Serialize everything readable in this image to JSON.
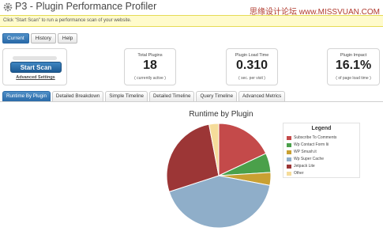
{
  "app": {
    "title": "P3 - Plugin Performance Profiler",
    "watermark": "思缘设计论坛 www.MISSVUAN.COM"
  },
  "notice": {
    "text": "Click \"Start Scan\" to run a performance scan of your website."
  },
  "top_tabs": [
    {
      "label": "Current",
      "active": true
    },
    {
      "label": "History",
      "active": false
    },
    {
      "label": "Help",
      "active": false
    }
  ],
  "scan": {
    "button_label": "Start Scan",
    "advanced_link": "Advanced Settings"
  },
  "metrics": {
    "total_plugins": {
      "title": "Total Plugins",
      "value": "18",
      "note": "( currently active )"
    },
    "load_time": {
      "title": "Plugin Load Time",
      "value": "0.310",
      "note": "( sec. per visit )"
    },
    "impact": {
      "title": "Plugin Impact",
      "value": "16.1%",
      "note": "( of page load time )"
    }
  },
  "view_tabs": [
    {
      "label": "Runtime By Plugin",
      "active": true
    },
    {
      "label": "Detailed Breakdown",
      "active": false
    },
    {
      "label": "Simple Timeline",
      "active": false
    },
    {
      "label": "Detailed Timeline",
      "active": false
    },
    {
      "label": "Query Timeline",
      "active": false
    },
    {
      "label": "Advanced Metrics",
      "active": false
    }
  ],
  "chart_data": {
    "type": "pie",
    "title": "Runtime by Plugin",
    "legend_title": "Legend",
    "legend_position": "right",
    "categories": [
      "Subscribe To Comments",
      "Wp Contact Form Iii",
      "WP Smush.it",
      "Wp Super Cache",
      "Jetpack Lite",
      "Other"
    ],
    "values": [
      18,
      6,
      4,
      42,
      27,
      3
    ],
    "colors": [
      "#c44a4a",
      "#4aa04a",
      "#c9a032",
      "#8faec9",
      "#9c3636",
      "#f5dc9a"
    ]
  }
}
